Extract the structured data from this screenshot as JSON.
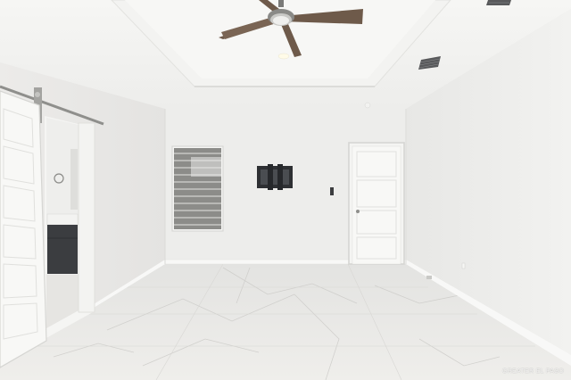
{
  "scene": {
    "subject": "ceiling-fan",
    "colors": {
      "wall": "#ececea",
      "ceiling": "#f4f4f2",
      "floor": "#e7e6e3",
      "blind": "#8b8b88",
      "door": "#f7f7f5",
      "fan_blade": "#6e5a4a",
      "vanity": "#3b3d40"
    }
  },
  "watermark": {
    "text": "GREATER EL PASO"
  }
}
